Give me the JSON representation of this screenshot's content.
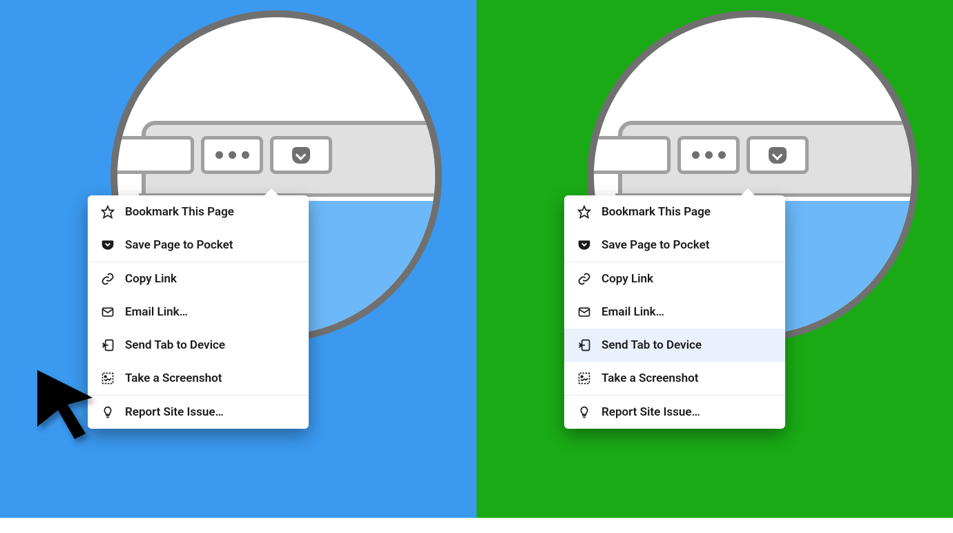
{
  "panels": {
    "left": {
      "bg": "#3B99F0",
      "pointer": "mouse-cursor"
    },
    "right": {
      "bg": "#1AAA15",
      "pointer": "touch-finger",
      "highlighted_index": 4
    }
  },
  "menu": {
    "items": [
      {
        "icon": "star-icon",
        "label": "Bookmark This Page"
      },
      {
        "icon": "pocket-icon",
        "label": "Save Page to Pocket"
      },
      {
        "divider": true
      },
      {
        "icon": "link-icon",
        "label": "Copy Link"
      },
      {
        "icon": "mail-icon",
        "label": "Email Link…"
      },
      {
        "icon": "send-device-icon",
        "label": "Send Tab to Device"
      },
      {
        "icon": "screenshot-icon",
        "label": "Take a Screenshot"
      },
      {
        "divider": true
      },
      {
        "icon": "bulb-icon",
        "label": "Report Site Issue…"
      }
    ]
  }
}
